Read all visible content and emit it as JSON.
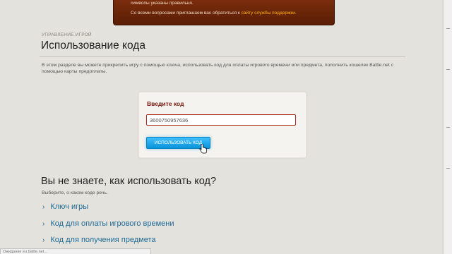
{
  "notice": {
    "line1": "символы указаны правильно.",
    "line2_prefix": "Со всеми вопросами приглашаем вас обратиться к ",
    "line2_link": "сайту службы поддержки",
    "line2_suffix": "."
  },
  "section": {
    "label": "УПРАВЛЕНИЕ ИГРОЙ",
    "title": "Использование кода",
    "intro": "В этом разделе вы можете прикрепить игру с помощью ключа, использовать код для оплаты игрового времени или предмета, пополнить кошелек Battle.net с помощью карты предоплаты."
  },
  "code_form": {
    "label": "Введите код",
    "input_value": "3600750957636",
    "button_label": "ИСПОЛЬЗОВАТЬ КОД"
  },
  "help": {
    "title": "Вы не знаете, как использовать код?",
    "subtitle": "Выберите, о каком коде речь.",
    "links": [
      {
        "label": "Ключ игры",
        "icon": "chevron-right-icon"
      },
      {
        "label": "Код для оплаты игрового времени",
        "icon": "chevron-right-icon"
      },
      {
        "label": "Код для получения предмета",
        "icon": "chevron-right-icon"
      }
    ]
  },
  "status_bar": {
    "text": "Ожидание eu.battle.net..."
  },
  "colors": {
    "accent_blue": "#0a92d8",
    "link_blue": "#1e6a96",
    "label_red": "#7a1a10",
    "notice_brown": "#5a1e06",
    "notice_link": "#ffb400"
  }
}
